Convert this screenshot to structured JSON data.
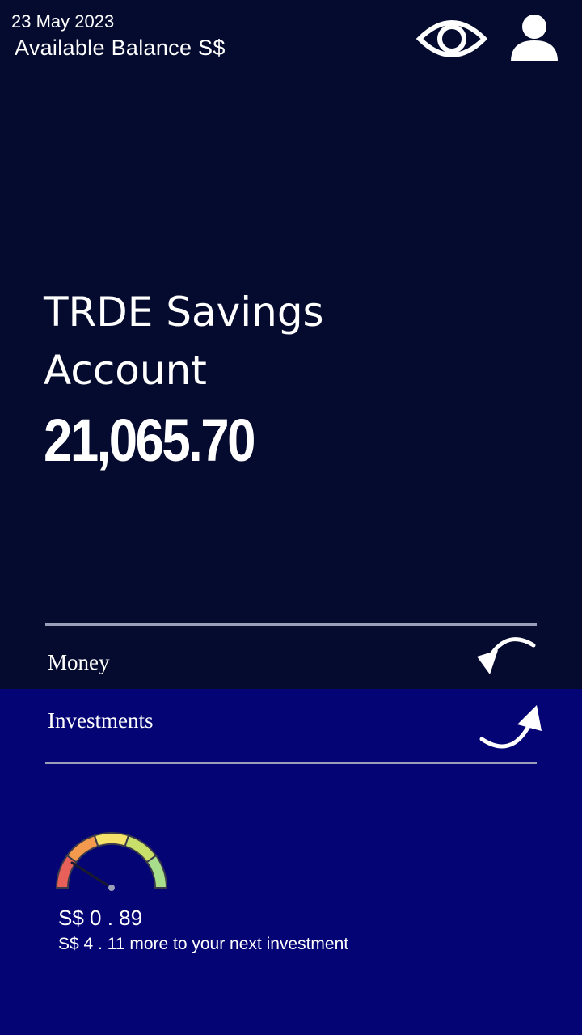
{
  "header": {
    "date": "23 May 2023",
    "balance_label": "Available Balance S$",
    "eye_icon": "eye-icon",
    "user_icon": "user-icon"
  },
  "account": {
    "title": "TRDE Savings Account",
    "balance": "21,065.70"
  },
  "nav": {
    "money_label": "Money",
    "money_icon": "curved-arrow-down-left-icon",
    "investments_label": "Investments",
    "investments_icon": "curved-arrow-up-right-icon"
  },
  "investment_progress": {
    "current_amount": "S$ 0 . 89",
    "remaining_note": "S$ 4 . 11 more to your next investment",
    "gauge_fraction": 0.18
  },
  "colors": {
    "top_background": "#050b2e",
    "bottom_background": "#040474",
    "gauge_segments": [
      "#e8605a",
      "#f39a4e",
      "#f5e26a",
      "#c8e06a",
      "#a8dd8c"
    ]
  }
}
